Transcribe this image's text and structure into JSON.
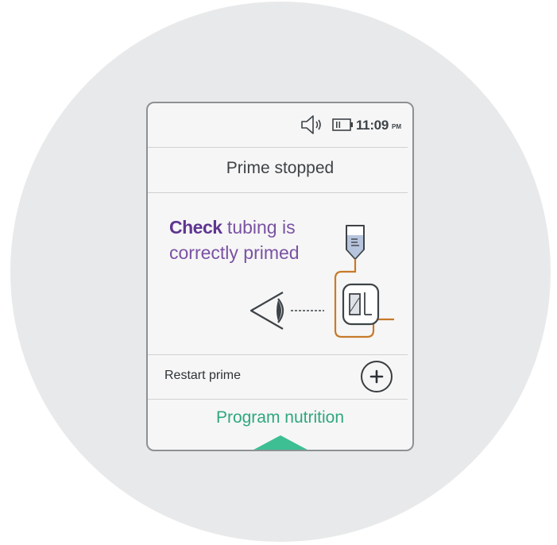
{
  "status": {
    "time": "11:09",
    "ampm": "PM",
    "speaker_icon": "speaker-icon",
    "battery_icon": "battery-icon"
  },
  "screen": {
    "title": "Prime stopped",
    "instruction_emphasis": "Check",
    "instruction_rest": " tubing is correctly primed"
  },
  "actions": {
    "restart_label": "Restart prime",
    "restart_icon": "plus-icon",
    "program_label": "Program nutrition"
  },
  "colors": {
    "accent_purple": "#7a52a3",
    "accent_green": "#2fa77c",
    "tubing_orange": "#c77a2a"
  }
}
